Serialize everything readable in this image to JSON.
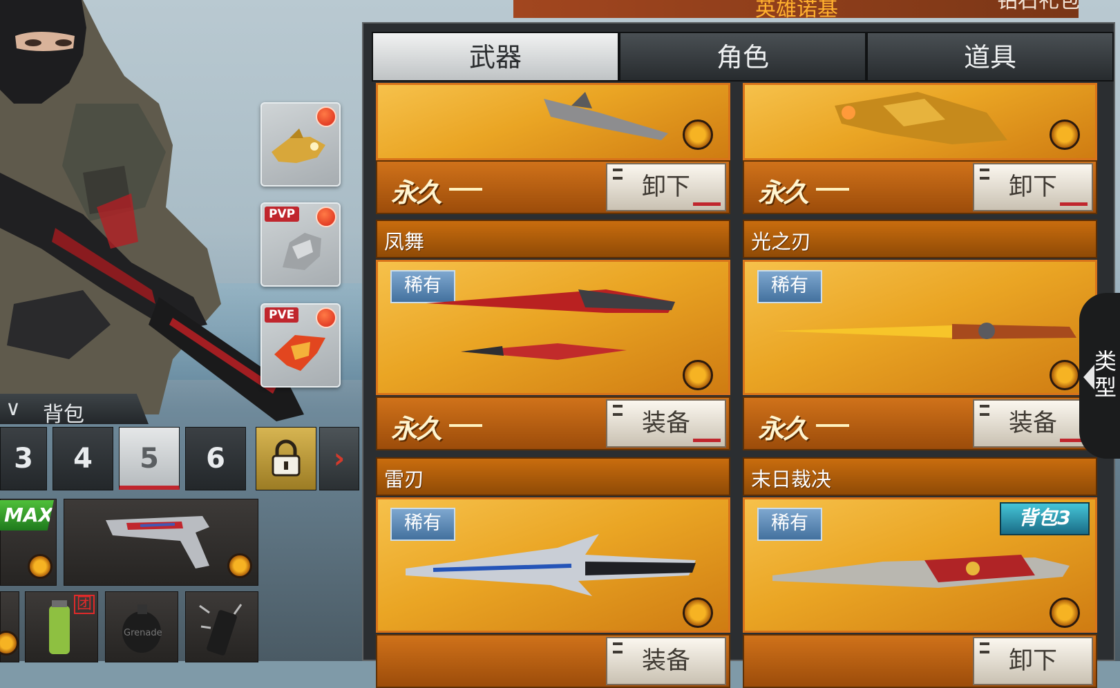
{
  "announcement": {
    "prefix": "钻石礼包大奖公告:",
    "highlight": "英雄诺基"
  },
  "tabs": [
    {
      "label": "武器",
      "active": true
    },
    {
      "label": "角色",
      "active": false
    },
    {
      "label": "道具",
      "active": false
    }
  ],
  "mode_badges": [
    {
      "tag": "",
      "icon": "golden-wolf-emblem"
    },
    {
      "tag": "PVP",
      "icon": "silver-horse-emblem"
    },
    {
      "tag": "PVE",
      "icon": "flame-phoenix-emblem"
    }
  ],
  "backpack": {
    "title": "背包",
    "slots": [
      "3",
      "4",
      "5",
      "6"
    ],
    "selected_slot": "5",
    "max_label": "MAX"
  },
  "weapons": [
    {
      "name": "",
      "rarity": "",
      "duration": "永久",
      "action": "卸下",
      "bag_badge": ""
    },
    {
      "name": "",
      "rarity": "",
      "duration": "永久",
      "action": "卸下",
      "bag_badge": ""
    },
    {
      "name": "凤舞",
      "rarity": "稀有",
      "duration": "永久",
      "action": "装备",
      "bag_badge": ""
    },
    {
      "name": "光之刃",
      "rarity": "稀有",
      "duration": "永久",
      "action": "装备",
      "bag_badge": ""
    },
    {
      "name": "雷刃",
      "rarity": "稀有",
      "duration": "",
      "action": "装备",
      "bag_badge": ""
    },
    {
      "name": "末日裁决",
      "rarity": "稀有",
      "duration": "",
      "action": "卸下",
      "bag_badge": "背包3"
    }
  ],
  "side_tab": "类型",
  "grenade_label": "Grenade",
  "team_badge": "团",
  "colors": {
    "accent_orange": "#e39a22",
    "rare_blue": "#5f8cba",
    "badge_red": "#c0262d"
  }
}
